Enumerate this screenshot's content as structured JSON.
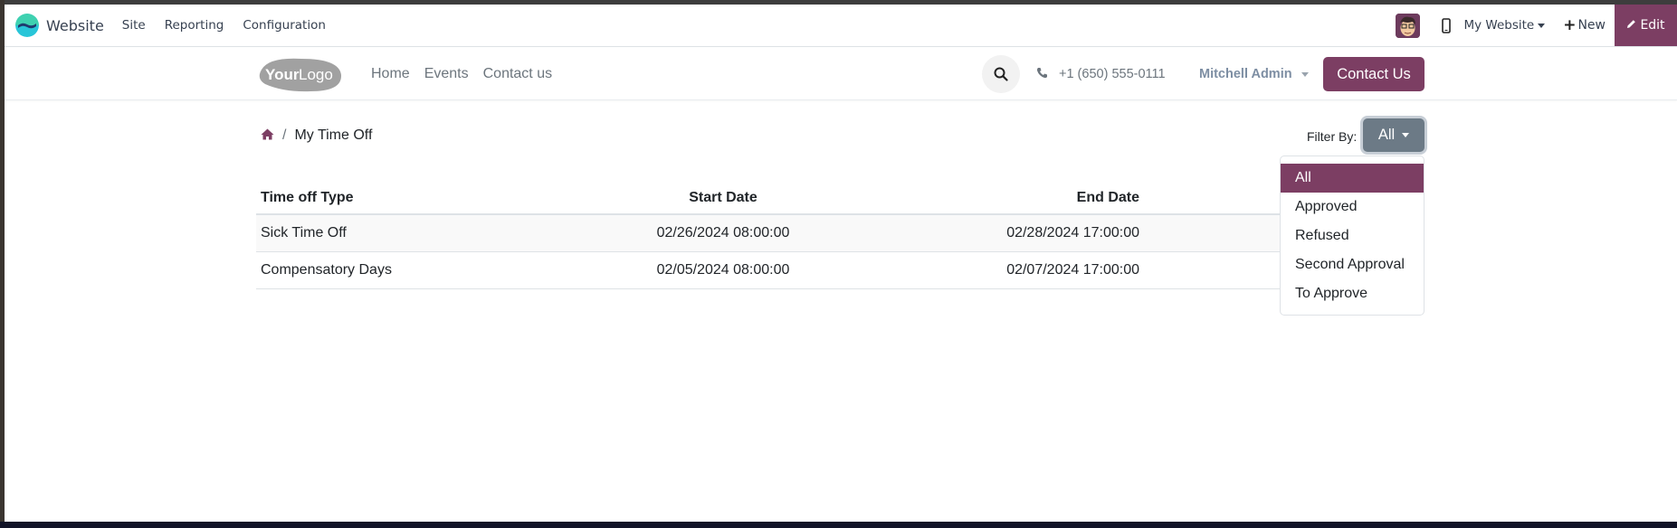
{
  "odoo_navbar": {
    "app_name": "Website",
    "menus": [
      "Site",
      "Reporting",
      "Configuration"
    ],
    "website_selector": "My Website",
    "new_label": "New",
    "edit_label": "Edit",
    "accent_color": "#7c3e63"
  },
  "website_header": {
    "logo_text_bold": "Your",
    "logo_text_light": "Logo",
    "nav": [
      "Home",
      "Events",
      "Contact us"
    ],
    "phone": "+1 (650) 555-0111",
    "user_name": "Mitchell Admin",
    "cta_label": "Contact Us"
  },
  "breadcrumb": {
    "separator": "/",
    "current": "My Time Off"
  },
  "filter": {
    "label": "Filter By:",
    "selected": "All",
    "options": [
      "All",
      "Approved",
      "Refused",
      "Second Approval",
      "To Approve"
    ]
  },
  "table": {
    "columns": [
      "Time off Type",
      "Start Date",
      "End Date"
    ],
    "rows": [
      {
        "type": "Sick Time Off",
        "start": "02/26/2024 08:00:00",
        "end": "02/28/2024 17:00:00"
      },
      {
        "type": "Compensatory Days",
        "start": "02/05/2024 08:00:00",
        "end": "02/07/2024 17:00:00"
      }
    ]
  }
}
